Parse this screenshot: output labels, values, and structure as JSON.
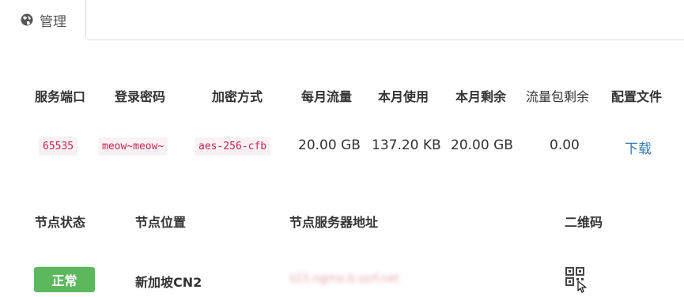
{
  "tab": {
    "label": "管理"
  },
  "account": {
    "headers": [
      "服务端口",
      "登录密码",
      "加密方式",
      "每月流量",
      "本月使用",
      "本月剩余",
      "流量包剩余",
      "配置文件"
    ],
    "port": "65535",
    "password": "meow~meow~",
    "method": "aes-256-cfb",
    "monthly_traffic": "20.00 GB",
    "used_this_month": "137.20 KB",
    "remaining_this_month": "20.00 GB",
    "package_remaining": "0.00",
    "config_link": "下载"
  },
  "nodes": {
    "headers": [
      "节点状态",
      "节点位置",
      "节点服务器地址",
      "二维码"
    ],
    "rows": [
      {
        "status": "正常",
        "location": "新加坡CN2",
        "server": "s23.ngmx.b.ssrf.net"
      }
    ]
  },
  "colors": {
    "link": "#337ab7",
    "status_ok": "#5cb85c",
    "code_text": "#c7254e",
    "code_bg": "#f9f2f4"
  },
  "icons": {
    "tab": "globe-icon",
    "qr": "qr-code-icon"
  }
}
